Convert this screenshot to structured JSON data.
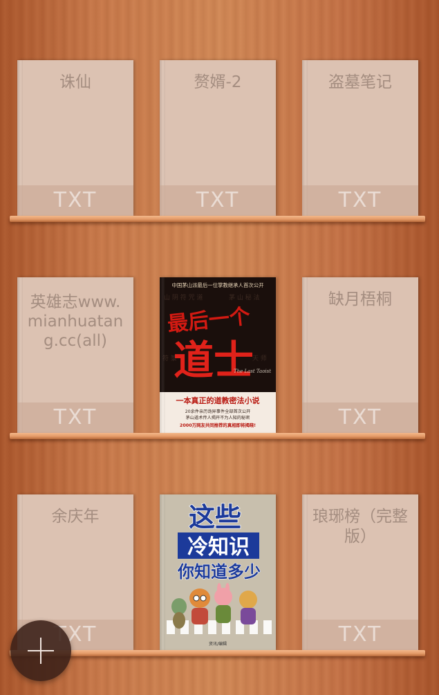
{
  "shelves": [
    {
      "books": [
        {
          "title": "诛仙",
          "type": "TXT"
        },
        {
          "title": "赘婿-2",
          "type": "TXT"
        },
        {
          "title": "盗墓笔记",
          "type": "TXT"
        }
      ]
    },
    {
      "books": [
        {
          "title": "英雄志www.mianhuatang.cc(all)",
          "type": "TXT"
        },
        {
          "cover": {
            "top_text": "中国茅山派最后一位掌教继承人首次公开",
            "title_small": "最后一个",
            "title_big": "道士",
            "english": "The Last Taoist",
            "banner": "一本真正的道教密法小说",
            "blurb_1": "20余件亲历诡异事件全部首次公开",
            "blurb_2": "茅山道术传人揭开不为人知的秘密",
            "tagline": "2000万网友共同推荐的真相即将揭晓!"
          }
        },
        {
          "title": "缺月梧桐",
          "type": "TXT"
        }
      ]
    },
    {
      "books": [
        {
          "title": "余庆年",
          "type": "TXT"
        },
        {
          "cover": {
            "line1": "这些",
            "line2": "冷知识",
            "line3": "你知道多少",
            "publisher": "资讯/编辑"
          }
        },
        {
          "title": "琅琊榜（完整版）",
          "type": "TXT"
        }
      ]
    }
  ],
  "fab": {
    "icon": "plus-icon",
    "label": "Add book"
  }
}
